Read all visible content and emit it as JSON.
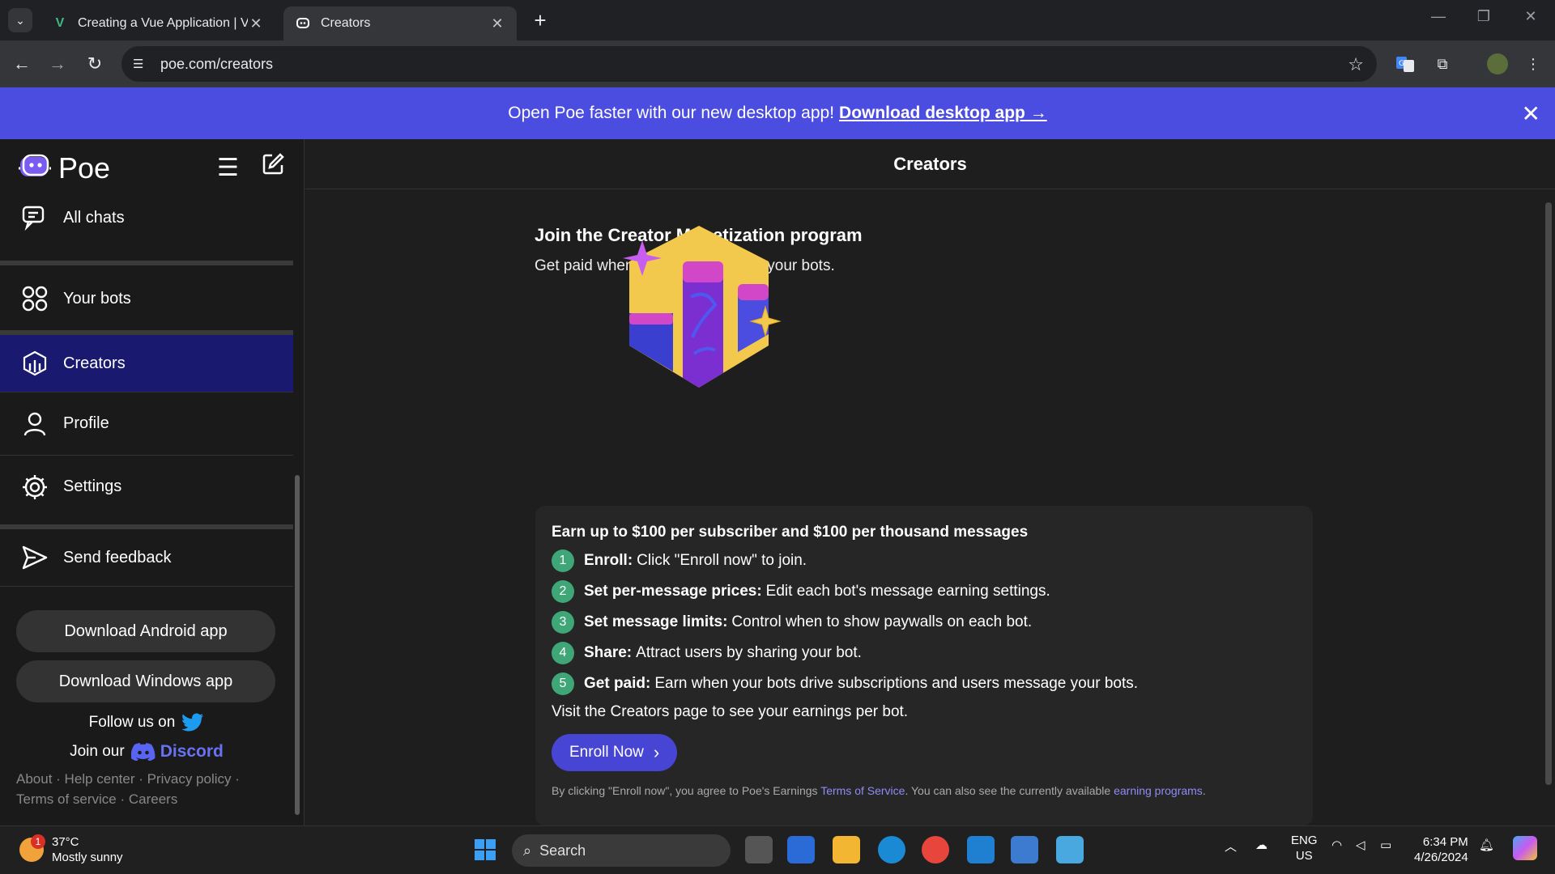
{
  "browser": {
    "tabs": [
      {
        "title": "Creating a Vue Application | Vu",
        "favicon": "V"
      },
      {
        "title": "Creators",
        "favicon": "poe"
      }
    ],
    "url": "poe.com/creators"
  },
  "banner": {
    "text": "Open Poe faster with our new desktop app!",
    "link": "Download desktop app →",
    "close": "✕"
  },
  "sidebar": {
    "logo_text": "Poe",
    "items": [
      {
        "label": "All chats",
        "icon": "chat-bubbles-icon"
      },
      {
        "label": "Your bots",
        "icon": "bots-grid-icon"
      },
      {
        "label": "Creators",
        "icon": "creators-icon"
      },
      {
        "label": "Profile",
        "icon": "person-icon"
      },
      {
        "label": "Settings",
        "icon": "gear-icon"
      },
      {
        "label": "Send feedback",
        "icon": "send-icon"
      }
    ],
    "download_android": "Download Android app",
    "download_windows": "Download Windows app",
    "follow_us": "Follow us on",
    "join_our": "Join our",
    "discord": "Discord",
    "footer": {
      "about": "About",
      "help": "Help center",
      "privacy": "Privacy policy",
      "terms": "Terms of service",
      "careers": "Careers"
    }
  },
  "main": {
    "header": "Creators",
    "title": "Join the Creator Monetization program",
    "subtitle": "Get paid when users engage with your bots.",
    "card": {
      "heading": "Earn up to $100 per subscriber and $100 per thousand messages",
      "steps": [
        {
          "num": "1",
          "bold": "Enroll:",
          "text": "Click \"Enroll now\" to join."
        },
        {
          "num": "2",
          "bold": "Set per-message prices:",
          "text": "Edit each bot's message earning settings."
        },
        {
          "num": "3",
          "bold": "Set message limits:",
          "text": "Control when to show paywalls on each bot."
        },
        {
          "num": "4",
          "bold": "Share:",
          "text": "Attract users by sharing your bot."
        },
        {
          "num": "5",
          "bold": "Get paid:",
          "text": "Earn when your bots drive subscriptions and users message your bots."
        }
      ],
      "visit": "Visit the Creators page to see your earnings per bot.",
      "enroll_button": "Enroll Now",
      "legal_prefix": "By clicking \"Enroll now\", you agree to Poe's Earnings",
      "legal_tos": "Terms of Service",
      "legal_mid": ". You can also see the currently available",
      "legal_programs": "earning programs",
      "legal_end": "."
    }
  },
  "taskbar": {
    "weather_temp": "37°C",
    "weather_desc": "Mostly sunny",
    "weather_badge": "1",
    "search_placeholder": "Search",
    "lang_top": "ENG",
    "lang_bottom": "US",
    "time": "6:34 PM",
    "date": "4/26/2024"
  },
  "colors": {
    "banner": "#4b4de0",
    "active_nav": "#191970",
    "accent_button": "#4745d4",
    "step_badge": "#3fa777",
    "hex_gold": "#f2c94c",
    "bar_purple": "#7b2fd0",
    "bar_pink": "#d147c8"
  }
}
